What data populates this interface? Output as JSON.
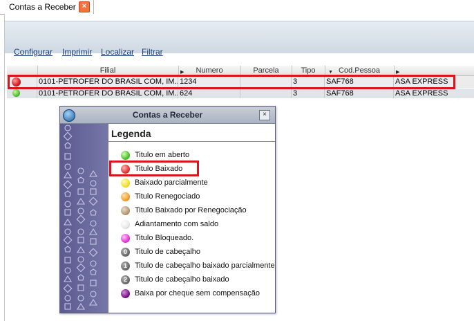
{
  "tab": {
    "label": "Contas a Receber",
    "close": "×"
  },
  "toolbar": {
    "configurar": "Configurar",
    "imprimir": "Imprimir",
    "localizar": "Localizar",
    "filtrar": "Filtrar"
  },
  "grid": {
    "headers": {
      "filial": "Filial",
      "numero": "Numero",
      "parcela": "Parcela",
      "tipo": "Tipo",
      "cod_pessoa": "Cod.Pessoa"
    },
    "rows": [
      {
        "status": "red",
        "filial": "0101-PETROFER DO BRASIL COM, IM...",
        "numero": "1234",
        "parcela": "",
        "tipo": "3",
        "cod_pessoa": "SAF768",
        "nome": "ASA EXPRESS"
      },
      {
        "status": "green",
        "filial": "0101-PETROFER DO BRASIL COM, IM...",
        "numero": "624",
        "parcela": "",
        "tipo": "3",
        "cod_pessoa": "SAF768",
        "nome": "ASA EXPRESS"
      }
    ]
  },
  "dialog": {
    "title": "Contas a Receber",
    "close": "×",
    "heading": "Legenda",
    "items": [
      {
        "label": "Titulo em aberto",
        "color": "#4fc231"
      },
      {
        "label": "Titulo Baixado",
        "color": "#e23737"
      },
      {
        "label": "Baixado parcialmente",
        "color": "#f3df2b"
      },
      {
        "label": "Titulo Renegociado",
        "color": "#f0a033"
      },
      {
        "label": "Titulo Baixado por Renegociação",
        "color": "#b49c78"
      },
      {
        "label": "Adiantamento com saldo",
        "color": "#e8e8e8"
      },
      {
        "label": "Titulo Bloqueado.",
        "color": "#e63ad7"
      },
      {
        "label": "Titulo de cabeçalho",
        "color": "#6e6e6e",
        "glyph": "0"
      },
      {
        "label": "Titulo de cabeçalho baixado parcialmente",
        "color": "#6e6e6e",
        "glyph": "1"
      },
      {
        "label": "Titulo de cabeçalho baixado",
        "color": "#6e6e6e",
        "glyph": "2"
      },
      {
        "label": "Baixa por cheque sem compensação",
        "color": "#7a1a86"
      }
    ]
  }
}
